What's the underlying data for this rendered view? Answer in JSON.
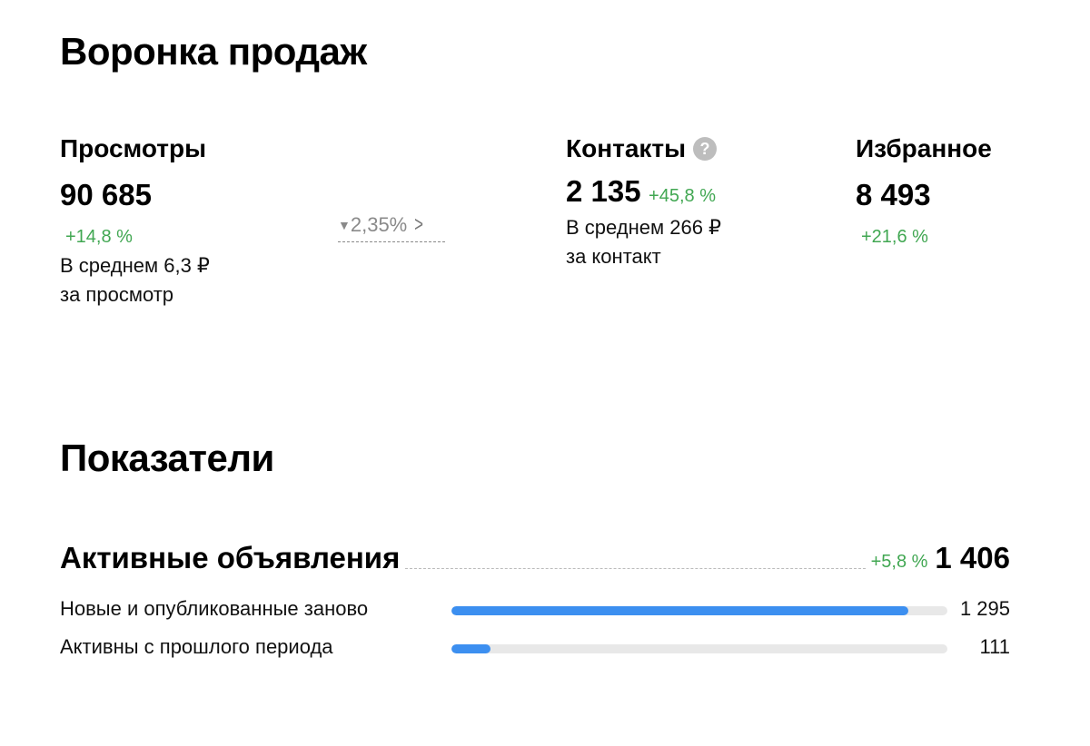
{
  "funnel": {
    "title": "Воронка продаж",
    "views": {
      "label": "Просмотры",
      "value": "90 685",
      "delta": "+14,8 %",
      "avg_line1": "В среднем 6,3 ₽",
      "avg_line2": "за просмотр"
    },
    "conversion": {
      "value": "2,35%",
      "icon": "funnel-icon",
      "chevron_icon": "chevron-right-icon"
    },
    "contacts": {
      "label": "Контакты",
      "help_icon": "help-icon",
      "help_glyph": "?",
      "value": "2 135",
      "delta": "+45,8 %",
      "avg_line1": "В среднем 266 ₽",
      "avg_line2": "за контакт"
    },
    "favorites": {
      "label": "Избранное",
      "value": "8 493",
      "delta": "+21,6 %"
    }
  },
  "indicators": {
    "title": "Показатели",
    "active_listings": {
      "label": "Активные объявления",
      "delta": "+5,8 %",
      "value": "1 406"
    },
    "rows": [
      {
        "label": "Новые и опубликованные заново",
        "value": "1 295",
        "fill_fraction": 0.921
      },
      {
        "label": "Активны с прошлого периода",
        "value": "111",
        "fill_fraction": 0.079
      }
    ],
    "bar_color": "#3c8ff0",
    "positive_color": "#41a752"
  }
}
